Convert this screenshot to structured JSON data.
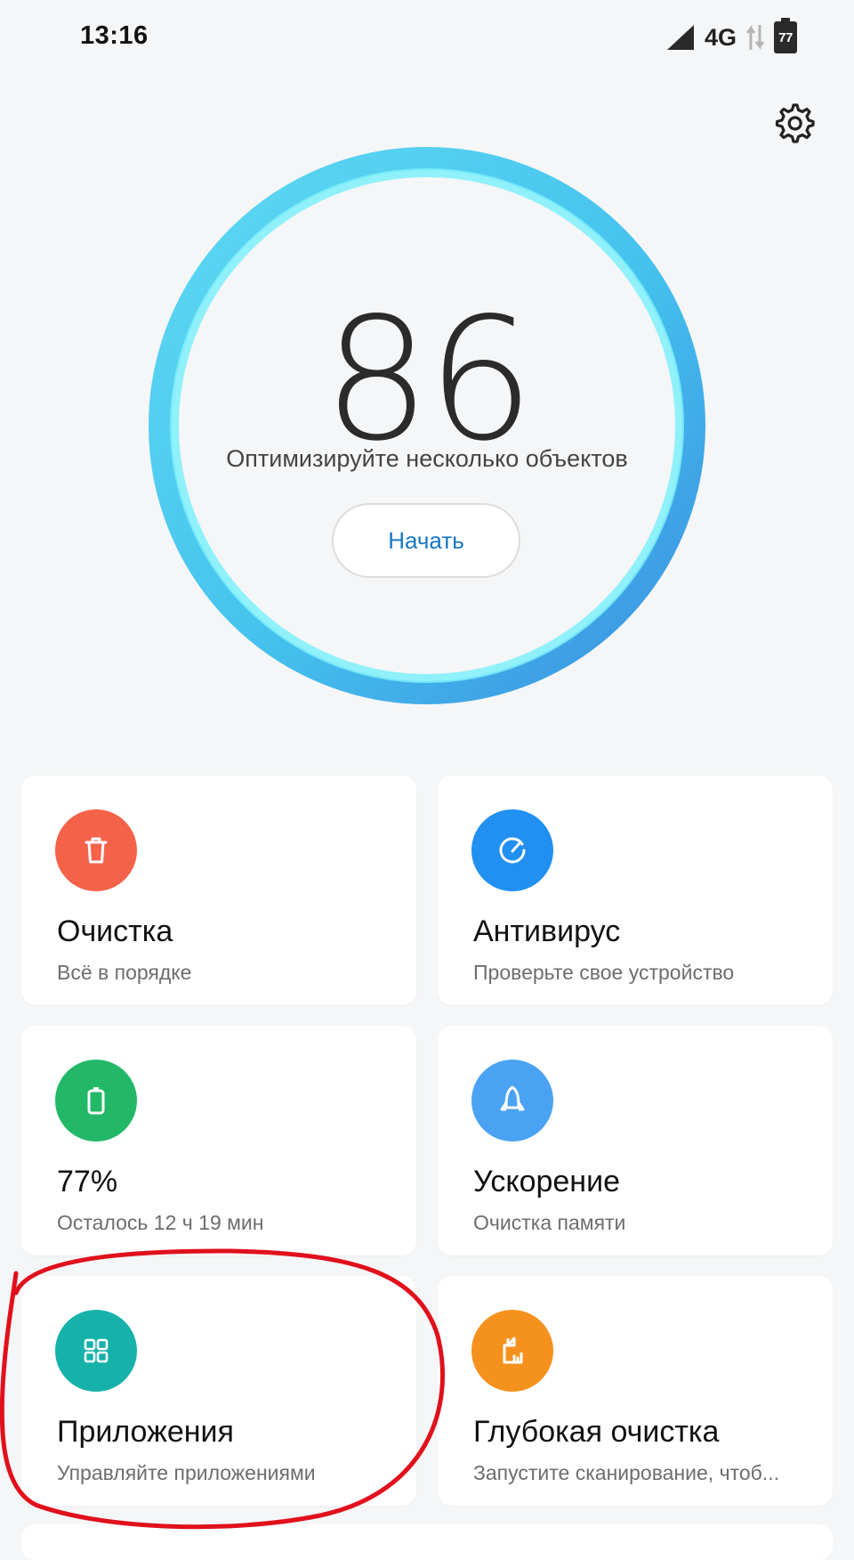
{
  "status_bar": {
    "time": "13:16",
    "network": "4G",
    "battery_level": "77"
  },
  "score": {
    "value": "86",
    "message": "Оптимизируйте несколько объектов",
    "start_label": "Начать"
  },
  "colors": {
    "ring_light": "#5ee6f6",
    "ring_dark": "#3a9be6",
    "clean": "#f4624a",
    "antivirus": "#2190f0",
    "battery": "#22b868",
    "boost": "#4aa3f2",
    "apps": "#16b2aa",
    "deep_clean": "#f5921e",
    "annotation": "#e0101c"
  },
  "tiles": [
    {
      "title": "Очистка",
      "subtitle": "Всё в порядке",
      "icon": "trash-icon"
    },
    {
      "title": "Антивирус",
      "subtitle": "Проверьте свое устройство",
      "icon": "gauge-icon"
    },
    {
      "title": "77%",
      "subtitle": "Осталось 12 ч 19 мин",
      "icon": "battery-icon"
    },
    {
      "title": "Ускорение",
      "subtitle": "Очистка памяти",
      "icon": "rocket-icon"
    },
    {
      "title": "Приложения",
      "subtitle": "Управляйте приложениями",
      "icon": "apps-grid-icon"
    },
    {
      "title": "Глубокая очистка",
      "subtitle": "Запустите сканирование, чтоб...",
      "icon": "broom-icon"
    }
  ]
}
